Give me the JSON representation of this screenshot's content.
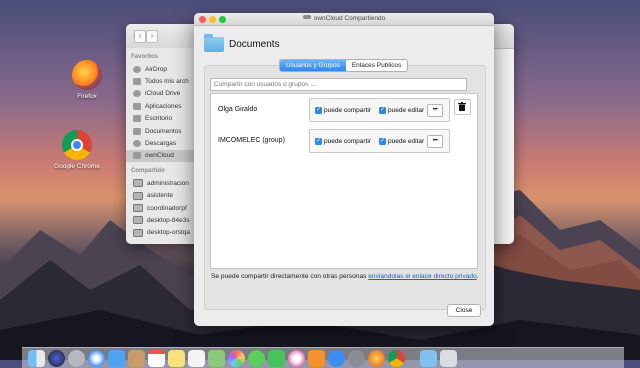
{
  "desktop": {
    "icons": [
      {
        "label": "Firefox"
      },
      {
        "label": "Google Chrome"
      }
    ]
  },
  "finder": {
    "nav_back": "‹",
    "nav_forward": "›",
    "sidebar": {
      "favorites_header": "Favoritos",
      "favorites": [
        "AirDrop",
        "Todos mis arch",
        "iCloud Drive",
        "Aplicaciones",
        "Escritorio",
        "Documentos",
        "Descargas",
        "ownCloud"
      ],
      "shared_header": "Compartido",
      "shared": [
        "administracion",
        "asistente",
        "coordinadorpf",
        "desktop-84e3s",
        "desktop-orstqa"
      ]
    }
  },
  "dialog": {
    "window_title": "ownCloud Compartiendo",
    "folder_name": "Documents",
    "tabs": [
      "Usuarios y Grupos",
      "Enlaces Publicos"
    ],
    "active_tab": "Usuarios y Grupos",
    "share_placeholder": "Compartir con usuarios o grupos ...",
    "shares": [
      {
        "name": "Olga Giraldo",
        "can_share_label": "puede compartir",
        "can_share": true,
        "can_edit_label": "puede editar",
        "can_edit": true,
        "more_label": "•••"
      },
      {
        "name": "IMCOMELEC (group)",
        "can_share_label": "puede compartir",
        "can_share": true,
        "can_edit_label": "puede editar",
        "can_edit": true,
        "more_label": "•••"
      }
    ],
    "footer_text": "Se puede compartir directamente con otras personas ",
    "footer_link": "enviandolas el enlace directo privado",
    "footer_end": ".",
    "close_label": "Close"
  },
  "colors": {
    "accent": "#2f86f0",
    "link": "#1f5fc8",
    "traffic_close": "#fc5f57",
    "traffic_min": "#fdbc2e",
    "traffic_max": "#28c840"
  },
  "dock": {
    "items": [
      "finder",
      "siri",
      "launchpad",
      "safari",
      "mail",
      "contacts",
      "calendar",
      "notes",
      "reminders",
      "maps",
      "photos",
      "messages",
      "facetime",
      "itunes",
      "ibooks",
      "app-store",
      "system-preferences",
      "firefox",
      "chrome",
      "folder",
      "trash"
    ]
  }
}
